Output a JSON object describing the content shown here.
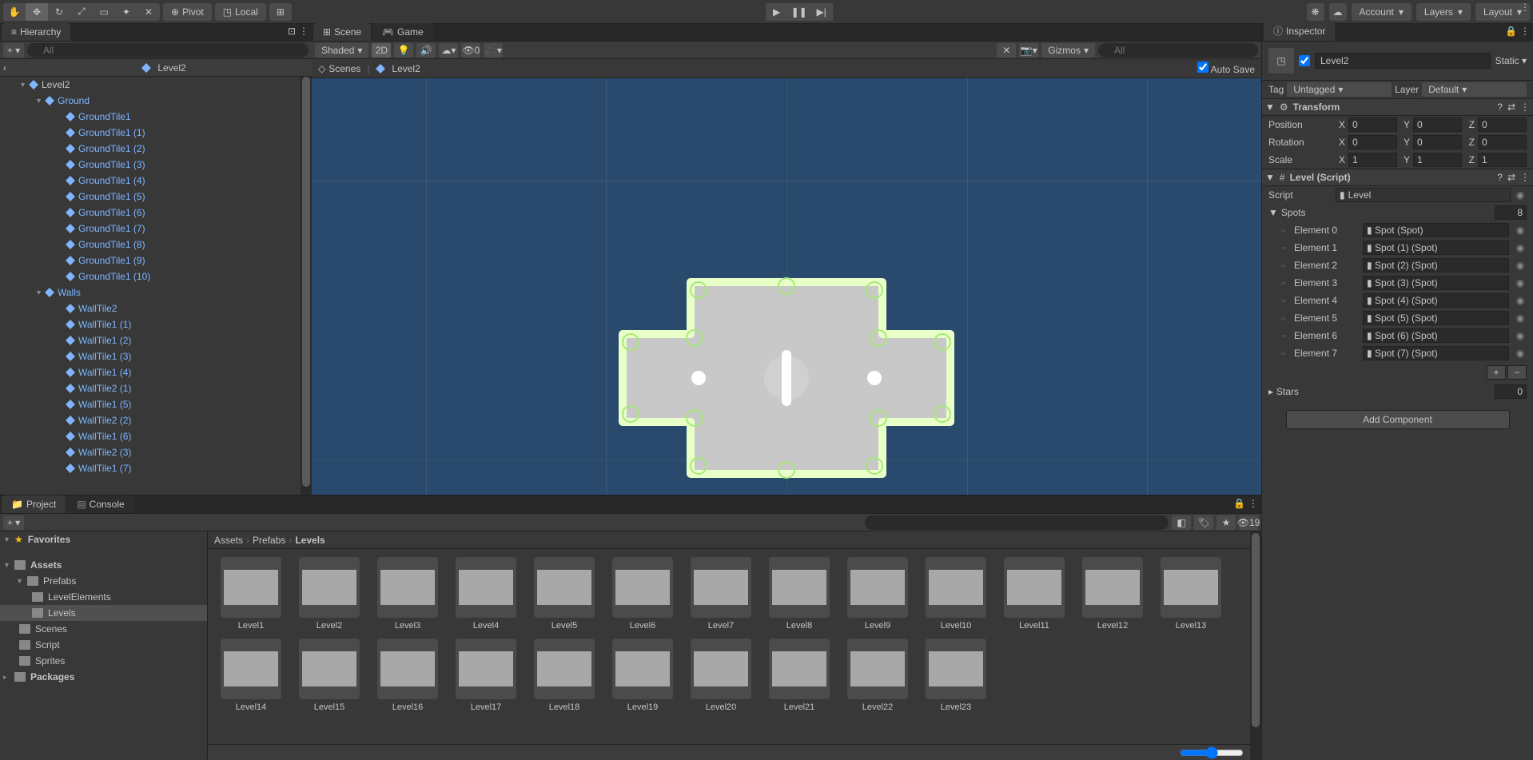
{
  "toolbar": {
    "pivot": "Pivot",
    "local": "Local",
    "account": "Account",
    "layers": "Layers",
    "layout": "Layout"
  },
  "hierarchy": {
    "title": "Hierarchy",
    "search_placeholder": "All",
    "prefab_context": "Level2",
    "root": "Level2",
    "ground": "Ground",
    "ground_items": [
      "GroundTile1",
      "GroundTile1 (1)",
      "GroundTile1 (2)",
      "GroundTile1 (3)",
      "GroundTile1 (4)",
      "GroundTile1 (5)",
      "GroundTile1 (6)",
      "GroundTile1 (7)",
      "GroundTile1 (8)",
      "GroundTile1 (9)",
      "GroundTile1 (10)"
    ],
    "walls": "Walls",
    "wall_items": [
      "WallTile2",
      "WallTile1 (1)",
      "WallTile1 (2)",
      "WallTile1 (3)",
      "WallTile1 (4)",
      "WallTile2 (1)",
      "WallTile1 (5)",
      "WallTile2 (2)",
      "WallTile1 (6)",
      "WallTile2 (3)",
      "WallTile1 (7)"
    ]
  },
  "scene": {
    "tab_scene": "Scene",
    "tab_game": "Game",
    "draw_mode": "Shaded",
    "mode_2d": "2D",
    "gizmos": "Gizmos",
    "search_placeholder": "All",
    "hidden_count": "0",
    "breadcrumb_scenes": "Scenes",
    "breadcrumb_level": "Level2",
    "auto_save": "Auto Save"
  },
  "inspector": {
    "title": "Inspector",
    "name": "Level2",
    "static": "Static",
    "tag_label": "Tag",
    "tag_value": "Untagged",
    "layer_label": "Layer",
    "layer_value": "Default",
    "transform": {
      "title": "Transform",
      "position": "Position",
      "rotation": "Rotation",
      "scale": "Scale",
      "px": "0",
      "py": "0",
      "pz": "0",
      "rx": "0",
      "ry": "0",
      "rz": "0",
      "sx": "1",
      "sy": "1",
      "sz": "1"
    },
    "level": {
      "title": "Level (Script)",
      "script_label": "Script",
      "script_value": "Level",
      "spots_label": "Spots",
      "spots_count": "8",
      "elements": [
        {
          "label": "Element 0",
          "value": "Spot (Spot)"
        },
        {
          "label": "Element 1",
          "value": "Spot (1) (Spot)"
        },
        {
          "label": "Element 2",
          "value": "Spot (2) (Spot)"
        },
        {
          "label": "Element 3",
          "value": "Spot (3) (Spot)"
        },
        {
          "label": "Element 4",
          "value": "Spot (4) (Spot)"
        },
        {
          "label": "Element 5",
          "value": "Spot (5) (Spot)"
        },
        {
          "label": "Element 6",
          "value": "Spot (6) (Spot)"
        },
        {
          "label": "Element 7",
          "value": "Spot (7) (Spot)"
        }
      ],
      "stars_label": "Stars",
      "stars_value": "0"
    },
    "add_component": "Add Component"
  },
  "project": {
    "tab_project": "Project",
    "tab_console": "Console",
    "hidden_count": "19",
    "favorites": "Favorites",
    "assets": "Assets",
    "prefabs": "Prefabs",
    "level_elements": "LevelElements",
    "levels": "Levels",
    "scenes": "Scenes",
    "script": "Script",
    "sprites": "Sprites",
    "packages": "Packages",
    "breadcrumb": [
      "Assets",
      "Prefabs",
      "Levels"
    ],
    "items": [
      "Level1",
      "Level2",
      "Level3",
      "Level4",
      "Level5",
      "Level6",
      "Level7",
      "Level8",
      "Level9",
      "Level10",
      "Level11",
      "Level12",
      "Level13",
      "Level14",
      "Level15",
      "Level16",
      "Level17",
      "Level18",
      "Level19",
      "Level20",
      "Level21",
      "Level22",
      "Level23"
    ]
  }
}
